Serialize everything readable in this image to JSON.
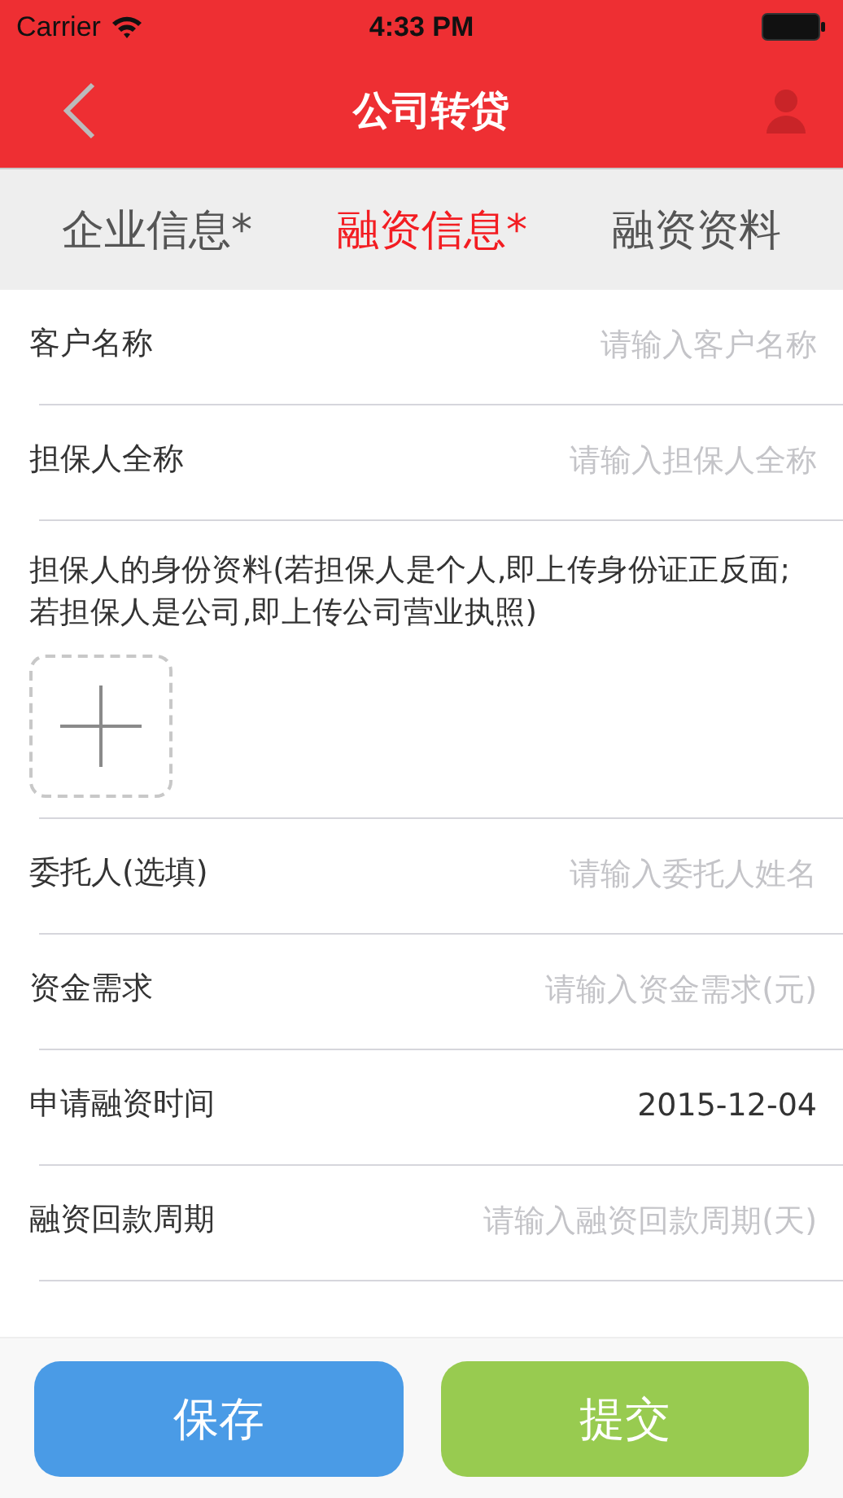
{
  "status_bar": {
    "carrier": "Carrier",
    "time": "4:33 PM"
  },
  "nav_bar": {
    "title": "公司转贷"
  },
  "tabs": [
    {
      "label": "企业信息*",
      "selected": false
    },
    {
      "label": "融资信息*",
      "selected": true
    },
    {
      "label": "融资资料",
      "selected": false
    }
  ],
  "form": [
    {
      "kind": "input",
      "label": "客户名称",
      "placeholder": "请输入客户名称"
    },
    {
      "kind": "input",
      "label": "担保人全称",
      "placeholder": "请输入担保人全称"
    },
    {
      "kind": "upload",
      "label": "担保人的身份资料(若担保人是个人,即上传身份证正反面;若担保人是公司,即上传公司营业执照)"
    },
    {
      "kind": "input",
      "label": "委托人(选填)",
      "placeholder": "请输入委托人姓名"
    },
    {
      "kind": "input",
      "label": "资金需求",
      "placeholder": "请输入资金需求(元)"
    },
    {
      "kind": "input",
      "label": "申请融资时间",
      "value": "2015-12-04"
    },
    {
      "kind": "input",
      "label": "融资回款周期",
      "placeholder": "请输入融资回款周期(天)"
    }
  ],
  "buttons": [
    {
      "label": "保存",
      "color": "#4a9be6"
    },
    {
      "label": "提交",
      "color": "#98cb50"
    }
  ]
}
